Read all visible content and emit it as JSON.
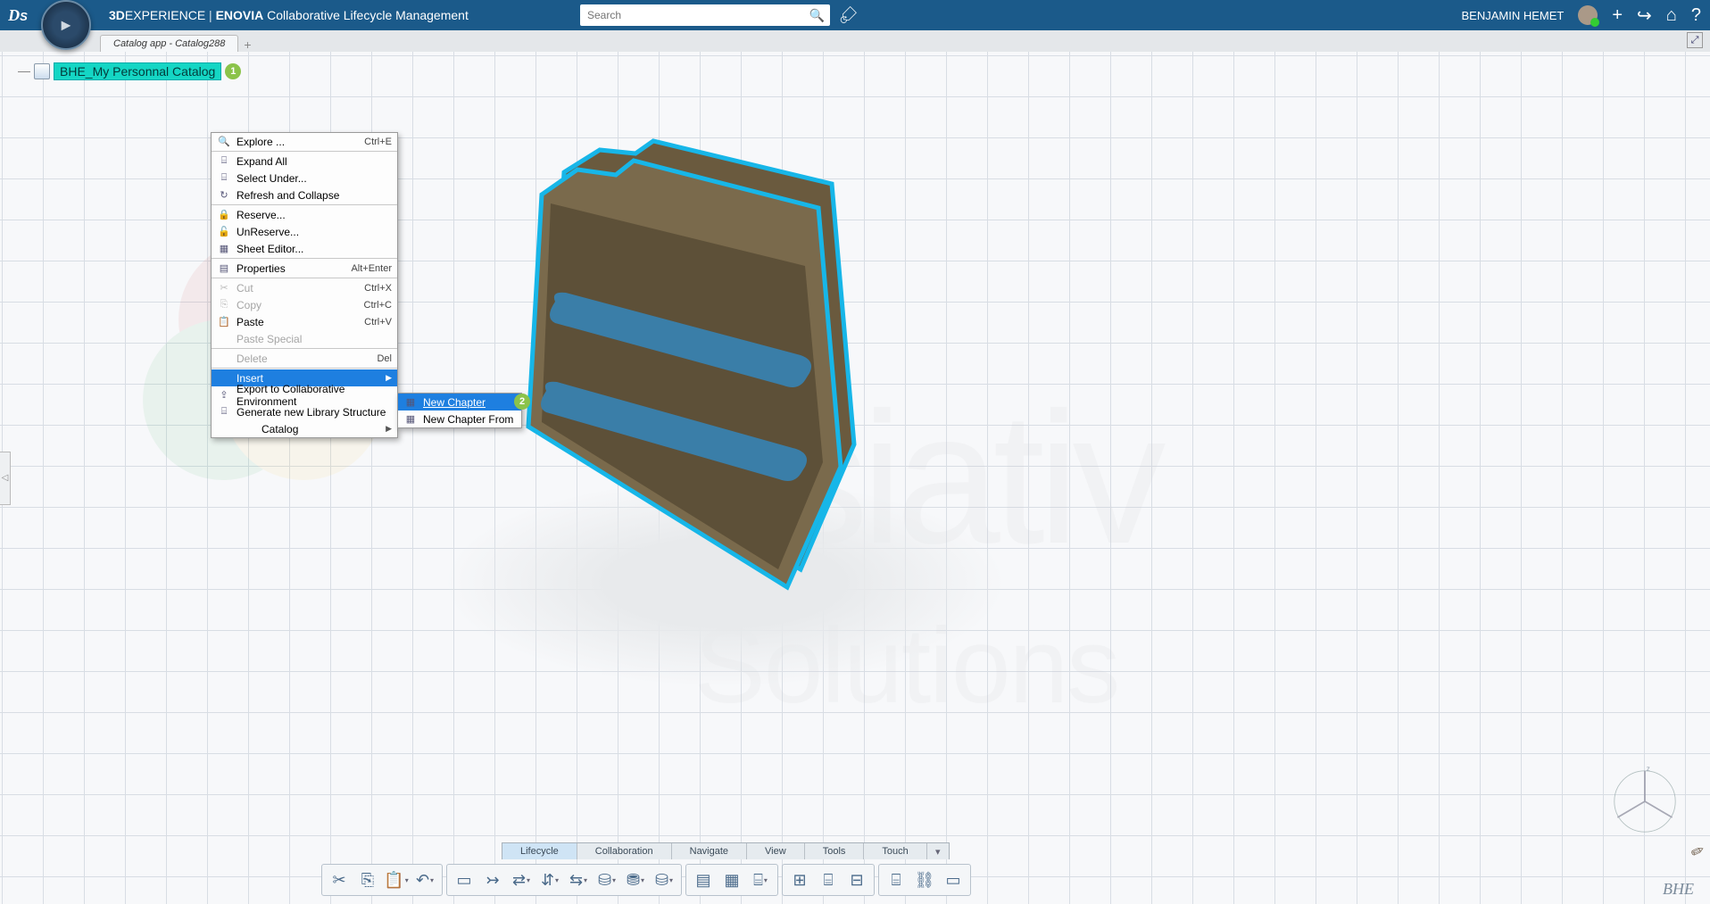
{
  "header": {
    "app_title_prefix": "3D",
    "app_title_rest": "EXPERIENCE",
    "product_brand": "ENOVIA",
    "product_name": "Collaborative Lifecycle Management",
    "search_placeholder": "Search",
    "user_name": "BENJAMIN HEMET"
  },
  "tab": {
    "title": "Catalog app - Catalog288"
  },
  "tree": {
    "node_label": "BHE_My Personnal Catalog",
    "badge1": "1"
  },
  "context_menu": {
    "items": [
      {
        "icon": "🔍",
        "label": "Explore ...",
        "shortcut": "Ctrl+E",
        "disabled": false
      },
      {
        "sep": true
      },
      {
        "icon": "⌸",
        "label": "Expand All",
        "disabled": false
      },
      {
        "icon": "⌸",
        "label": "Select Under...",
        "disabled": false
      },
      {
        "icon": "↻",
        "label": "Refresh and Collapse",
        "disabled": false
      },
      {
        "sep": true
      },
      {
        "icon": "🔒",
        "label": "Reserve...",
        "disabled": false
      },
      {
        "icon": "🔓",
        "label": "UnReserve...",
        "disabled": false
      },
      {
        "icon": "▦",
        "label": "Sheet Editor...",
        "disabled": false
      },
      {
        "sep": true
      },
      {
        "icon": "▤",
        "label": "Properties",
        "shortcut": "Alt+Enter",
        "disabled": false
      },
      {
        "sep": true
      },
      {
        "icon": "✂",
        "label": "Cut",
        "shortcut": "Ctrl+X",
        "disabled": true
      },
      {
        "icon": "⎘",
        "label": "Copy",
        "shortcut": "Ctrl+C",
        "disabled": true
      },
      {
        "icon": "📋",
        "label": "Paste",
        "shortcut": "Ctrl+V",
        "disabled": false
      },
      {
        "icon": "",
        "label": "Paste Special",
        "disabled": true
      },
      {
        "sep": true
      },
      {
        "icon": "",
        "label": "Delete",
        "shortcut": "Del",
        "disabled": true
      },
      {
        "sep": true
      },
      {
        "icon": "",
        "label": "Insert",
        "submenu": true,
        "hl": true
      },
      {
        "icon": "⇪",
        "label": "Export to Collaborative Environment",
        "disabled": false
      },
      {
        "icon": "⌸",
        "label": "Generate new Library Structure",
        "disabled": false
      },
      {
        "icon": "",
        "label": "Catalog",
        "submenu": true,
        "indent": true
      }
    ]
  },
  "submenu": {
    "items": [
      {
        "icon": "▦",
        "label": "New Chapter",
        "hl": true
      },
      {
        "icon": "▦",
        "label": "New Chapter From"
      }
    ],
    "badge2": "2"
  },
  "bottom_tabs": [
    "Lifecycle",
    "Collaboration",
    "Navigate",
    "View",
    "Tools",
    "Touch"
  ],
  "bottom_tabs_active": 0,
  "toolbar_groups": [
    [
      "✂",
      "⎘",
      "📋▾",
      "↶▾"
    ],
    [
      "▭",
      "↣",
      "⇄▾",
      "⇵▾",
      "⇆▾",
      "⛁▾",
      "⛃▾",
      "⛁▾"
    ],
    [
      "▤",
      "▦",
      "⌸▾"
    ],
    [
      "⊞",
      "⌸",
      "⊟"
    ],
    [
      "⌸",
      "⛓",
      "▭"
    ]
  ],
  "footer_sig": "BHE"
}
